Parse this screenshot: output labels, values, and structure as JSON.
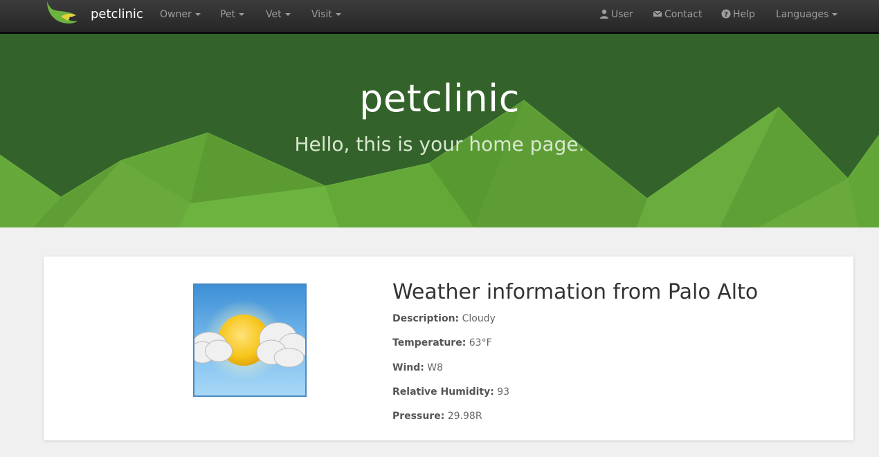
{
  "navbar": {
    "brand": "petclinic",
    "menus": [
      {
        "label": "Owner"
      },
      {
        "label": "Pet"
      },
      {
        "label": "Vet"
      },
      {
        "label": "Visit"
      }
    ],
    "user_label": "User",
    "contact_label": "Contact",
    "help_label": "Help",
    "languages_label": "Languages"
  },
  "hero": {
    "title": "petclinic",
    "subtitle": "Hello, this is your home page."
  },
  "weather": {
    "title": "Weather information from Palo Alto",
    "image_icon": "partly-cloudy-icon",
    "rows": [
      {
        "label": "Description:",
        "value": "Cloudy"
      },
      {
        "label": "Temperature:",
        "value": "63°F"
      },
      {
        "label": "Wind:",
        "value": "W8"
      },
      {
        "label": "Relative Humidity:",
        "value": "93"
      },
      {
        "label": "Pressure:",
        "value": "29.98R"
      }
    ]
  },
  "colors": {
    "navbar_bg": "#2b2b2b",
    "hero_dark_green": "#33632a",
    "hero_light_green": "#6db33f",
    "page_bg": "#f0f0f0"
  }
}
